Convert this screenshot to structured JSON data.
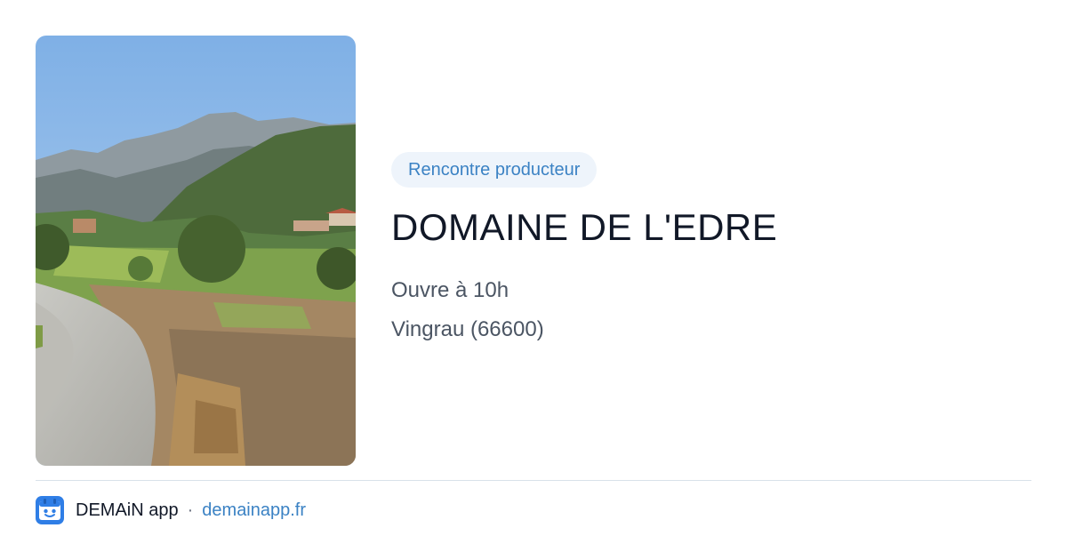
{
  "badge": "Rencontre producteur",
  "title": "DOMAINE DE L'EDRE",
  "hours": "Ouvre à 10h",
  "location": "Vingrau (66600)",
  "footer": {
    "app_name": "DEMAiN app",
    "separator": "·",
    "site": "demainapp.fr"
  },
  "icons": {
    "app": "demain-app-icon",
    "photo": "landscape-photo"
  },
  "colors": {
    "accent": "#3b82c4",
    "badge_bg": "#eef4fb",
    "title": "#111827",
    "meta": "#4b5563"
  }
}
